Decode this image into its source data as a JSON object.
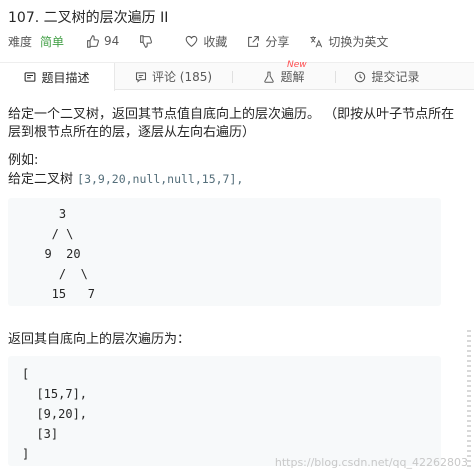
{
  "problem": {
    "title": "107. 二叉树的层次遍历 II",
    "difficulty_label": "难度",
    "difficulty": "简单",
    "likes": "94",
    "favorite_label": "收藏",
    "share_label": "分享",
    "switch_lang_label": "切换为英文"
  },
  "tabs": [
    {
      "label": "题目描述",
      "icon": "description-icon"
    },
    {
      "label": "评论 (185)",
      "icon": "comment-icon"
    },
    {
      "label": "题解",
      "icon": "flask-icon",
      "badge": "New"
    },
    {
      "label": "提交记录",
      "icon": "clock-icon"
    }
  ],
  "description": {
    "para1": "给定一个二叉树，返回其节点值自底向上的层次遍历。 （即按从叶子节点所在层到根节点所在的层，逐层从左向右遍历）",
    "example_label": "例如:",
    "given_prefix": "给定二叉树",
    "given_value": "[3,9,20,null,null,15,7],",
    "tree_lines": [
      "    3",
      "   / \\",
      "  9  20",
      "    /  \\",
      "   15   7"
    ],
    "result_label": "返回其自底向上的层次遍历为：",
    "result_lines": [
      "[",
      "  [15,7],",
      "  [9,20],",
      "  [3]",
      "]"
    ]
  },
  "watermark": "https://blog.csdn.net/qq_42262803",
  "colors": {
    "easy": "#43a047",
    "new_badge": "#ff4d4f",
    "code_bg": "#f7f9fa",
    "tabs_bg": "#fafafa"
  }
}
